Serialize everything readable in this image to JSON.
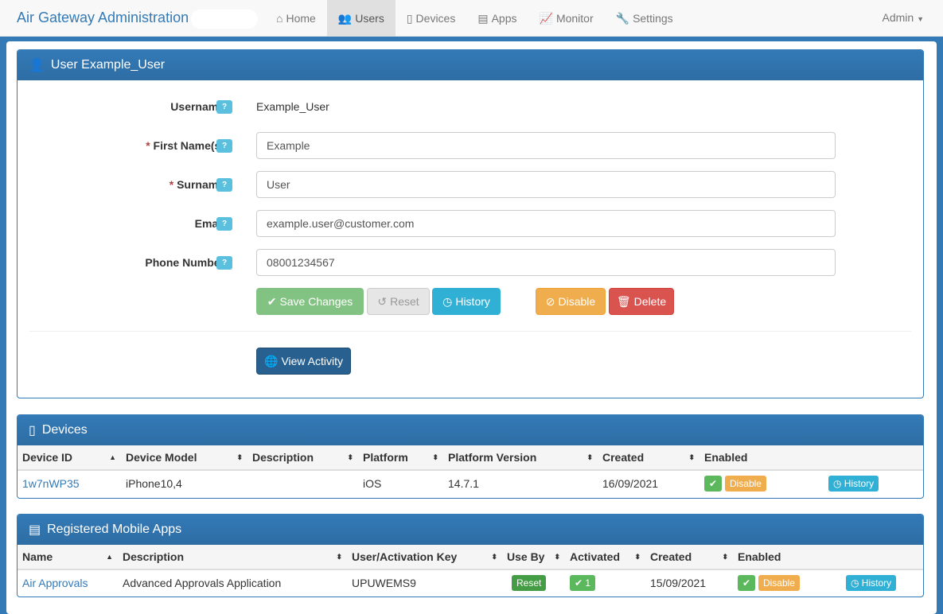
{
  "nav": {
    "brand": "Air Gateway Administration",
    "items": [
      {
        "label": "Home",
        "icon": "home-icon"
      },
      {
        "label": "Users",
        "icon": "users-icon"
      },
      {
        "label": "Devices",
        "icon": "mobile-icon"
      },
      {
        "label": "Apps",
        "icon": "apps-icon"
      },
      {
        "label": "Monitor",
        "icon": "chart-icon"
      },
      {
        "label": "Settings",
        "icon": "wrench-icon"
      }
    ],
    "user": "Admin"
  },
  "user_panel": {
    "title": "User Example_User",
    "help": "?",
    "fields": {
      "username_label": "Username",
      "username_value": "Example_User",
      "first_label": "First Name(s)",
      "first_value": "Example",
      "surname_label": "Surname",
      "surname_value": "User",
      "email_label": "Email",
      "email_value": "example.user@customer.com",
      "phone_label": "Phone Number",
      "phone_value": "08001234567"
    },
    "required_mark": "*",
    "buttons": {
      "save": "Save Changes",
      "reset": "Reset",
      "history": "History",
      "disable": "Disable",
      "delete": "Delete",
      "view_activity": "View Activity"
    }
  },
  "devices": {
    "title": "Devices",
    "columns": [
      "Device ID",
      "Device Model",
      "Description",
      "Platform",
      "Platform Version",
      "Created",
      "Enabled"
    ],
    "rows": [
      {
        "id": "1w7nWP35",
        "model": "iPhone10,4",
        "description": "",
        "platform": "iOS",
        "version": "14.7.1",
        "created": "16/09/2021",
        "disable": "Disable",
        "history": "History",
        "check": "✔"
      }
    ]
  },
  "apps": {
    "title": "Registered Mobile Apps",
    "columns": [
      "Name",
      "Description",
      "User/Activation Key",
      "Use By",
      "Activated",
      "Created",
      "Enabled"
    ],
    "rows": [
      {
        "name": "Air Approvals",
        "description": "Advanced Approvals Application",
        "key": "UPUWEMS9",
        "use_by": "Reset",
        "activated": "✔ 1",
        "created": "15/09/2021",
        "disable": "Disable",
        "history": "History",
        "check": "✔"
      }
    ]
  }
}
